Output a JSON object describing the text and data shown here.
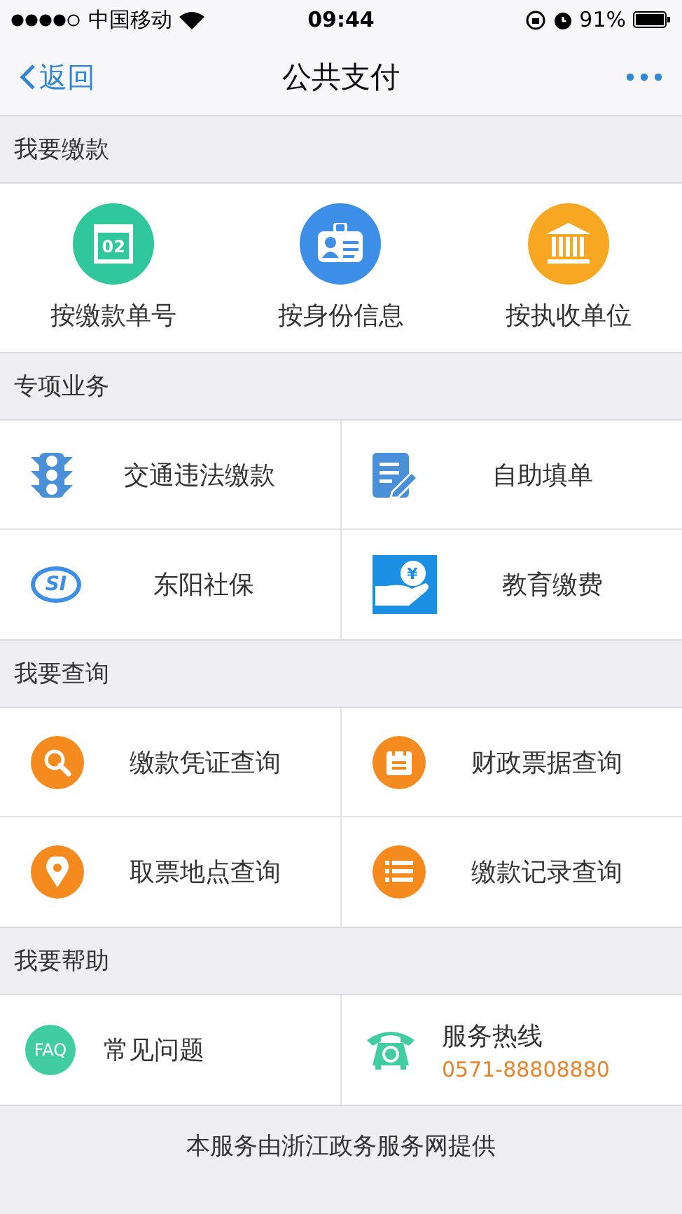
{
  "status_bar": {
    "carrier": "中国移动",
    "time": "09:44",
    "battery": "91%"
  },
  "nav": {
    "back": "返回",
    "title": "公共支付"
  },
  "sections": [
    {
      "title": "我要缴款",
      "kind": "big",
      "items": [
        {
          "label": "按缴款单号",
          "kind": "calendar",
          "glyph": "02"
        },
        {
          "label": "按身份信息",
          "kind": "idcard"
        },
        {
          "label": "按执收单位",
          "kind": "bank"
        }
      ]
    },
    {
      "title": "专项业务",
      "kind": "grid",
      "items": [
        {
          "label": "交通违法缴款",
          "kind": "traffic"
        },
        {
          "label": "自助填单",
          "kind": "notepen"
        },
        {
          "label": "东阳社保",
          "kind": "si",
          "glyph": "SI"
        },
        {
          "label": "教育缴费",
          "kind": "coin",
          "glyph": "¥"
        }
      ]
    },
    {
      "title": "我要查询",
      "kind": "grid",
      "items": [
        {
          "label": "缴款凭证查询",
          "kind": "search"
        },
        {
          "label": "财政票据查询",
          "kind": "notepad"
        },
        {
          "label": "取票地点查询",
          "kind": "pin"
        },
        {
          "label": "缴款记录查询",
          "kind": "list"
        }
      ]
    },
    {
      "title": "我要帮助",
      "kind": "help",
      "items": [
        {
          "label": "常见问题",
          "kind": "faq",
          "glyph": "FAQ"
        },
        {
          "label": "服务热线",
          "kind": "phone",
          "sub": "0571-88808880"
        }
      ]
    }
  ],
  "footer": "本服务由浙江政务服务网提供"
}
